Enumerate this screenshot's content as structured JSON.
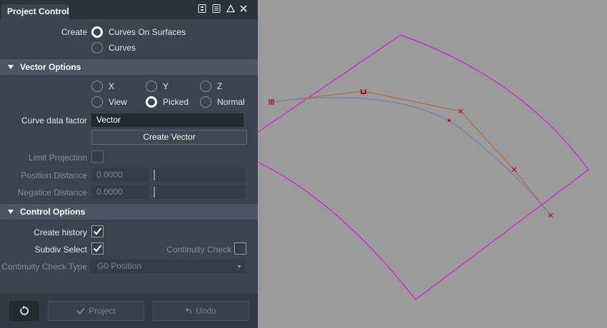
{
  "panel": {
    "title": "Project Control",
    "title_icons": [
      "sort-icon",
      "list-icon",
      "triangle-icon",
      "close-icon"
    ],
    "create": {
      "label": "Create",
      "options": [
        {
          "label": "Curves On Surfaces",
          "selected": true
        },
        {
          "label": "Curves",
          "selected": false
        }
      ]
    },
    "vector_options": {
      "title": "Vector Options",
      "options": [
        {
          "label": "X",
          "selected": false
        },
        {
          "label": "Y",
          "selected": false
        },
        {
          "label": "Z",
          "selected": false
        },
        {
          "label": "View",
          "selected": false
        },
        {
          "label": "Picked",
          "selected": true
        },
        {
          "label": "Normal",
          "selected": false
        }
      ],
      "curve_data_factor_label": "Curve data factor",
      "curve_data_factor_value": "Vector",
      "create_vector_button": "Create Vector",
      "limit_projection_label": "Limit Projection",
      "limit_projection_checked": false,
      "position_distance_label": "Position Distance",
      "position_distance_value": "0.0000",
      "negative_distance_label": "Negatice Distance",
      "negative_distance_value": "0.0000"
    },
    "control_options": {
      "title": "Control Options",
      "create_history_label": "Create history",
      "create_history_checked": true,
      "subdiv_select_label": "Subdiv Select",
      "subdiv_select_checked": true,
      "continuity_check_label": "Continuity Check",
      "continuity_check_checked": false,
      "continuity_check_type_label": "Continuity Check Type",
      "continuity_check_type_value": "G0 Position"
    },
    "footer": {
      "reset_icon": "reset-icon",
      "project_button": "Project",
      "undo_button": "Undo"
    }
  },
  "viewport": {
    "surface_color": "#cc22cc",
    "curve_color": "#7a82a6",
    "hull_color": "#b06b4a",
    "cv_color": "#b01030"
  }
}
